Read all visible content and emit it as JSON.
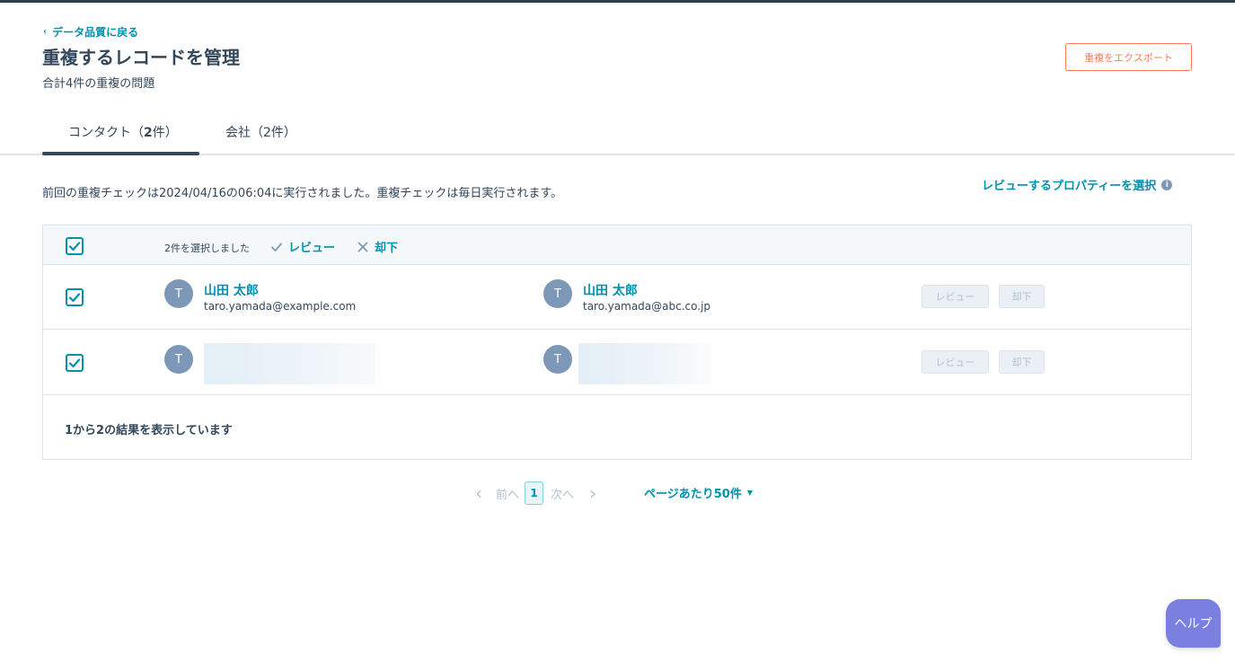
{
  "nav": {
    "back_label": "データ品質に戻る"
  },
  "header": {
    "title": "重複するレコードを管理",
    "subtitle": "合計4件の重複の問題",
    "export_label": "重複をエクスポート"
  },
  "tabs": {
    "contacts_prefix": "コンタクト（",
    "contacts_count": "2",
    "contacts_suffix": "件）",
    "companies_label": "会社（2件）"
  },
  "info": {
    "last_check": "前回の重複チェックは2024/04/16の06:04に実行されました。重複チェックは毎日実行されます。",
    "select_properties": "レビューするプロパティーを選択",
    "info_icon": "i"
  },
  "table": {
    "selected_count": "2件を選択しました",
    "bulk_review": "レビュー",
    "bulk_reject": "却下",
    "rows": [
      {
        "checked": true,
        "a": {
          "initial": "T",
          "name": "山田 太郎",
          "email": "taro.yamada@example.com"
        },
        "b": {
          "initial": "T",
          "name": "山田 太郎",
          "email": "taro.yamada@abc.co.jp"
        },
        "review_label": "レビュー",
        "reject_label": "却下"
      },
      {
        "checked": true,
        "a": {
          "initial": "T"
        },
        "b": {
          "initial": "T"
        },
        "review_label": "レビュー",
        "reject_label": "却下"
      }
    ],
    "result_text": "1から2の結果を表示しています"
  },
  "pagination": {
    "prev": "前へ",
    "current": "1",
    "next": "次へ",
    "per_page": "ページあたり50件"
  },
  "help": {
    "label": "ヘルプ"
  },
  "colors": {
    "accent": "#0091ae",
    "export": "#ff7a59",
    "text": "#33475b",
    "avatar": "#7c98b6",
    "help": "#7b80e0"
  }
}
